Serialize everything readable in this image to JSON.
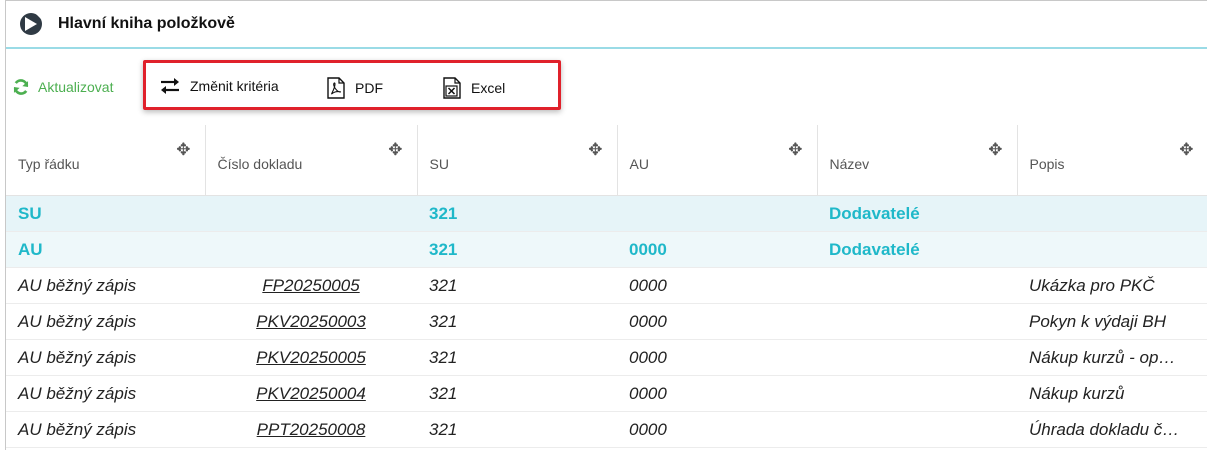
{
  "window": {
    "title": "Hlavní kniha položkově"
  },
  "toolbar": {
    "refresh_label": "Aktualizovat",
    "change_criteria_label": "Změnit kritéria",
    "pdf_label": "PDF",
    "excel_label": "Excel",
    "highlight_color": "#e0212b",
    "refresh_color": "#4caf50"
  },
  "table": {
    "headers": [
      "Typ řádku",
      "Číslo dokladu",
      "SU",
      "AU",
      "Název",
      "Popis"
    ],
    "rows": [
      {
        "type": "SU",
        "doc": "",
        "su": "321",
        "au": "",
        "name": "Dodavatelé",
        "desc": ""
      },
      {
        "type": "AU",
        "doc": "",
        "su": "321",
        "au": "0000",
        "name": "Dodavatelé",
        "desc": ""
      },
      {
        "type": "AU běžný zápis",
        "doc": "FP20250005",
        "su": "321",
        "au": "0000",
        "name": "",
        "desc": "Ukázka pro PKČ"
      },
      {
        "type": "AU běžný zápis",
        "doc": "PKV20250003",
        "su": "321",
        "au": "0000",
        "name": "",
        "desc": "Pokyn k výdaji BH"
      },
      {
        "type": "AU běžný zápis",
        "doc": "PKV20250005",
        "su": "321",
        "au": "0000",
        "name": "",
        "desc": "Nákup kurzů - op…"
      },
      {
        "type": "AU běžný zápis",
        "doc": "PKV20250004",
        "su": "321",
        "au": "0000",
        "name": "",
        "desc": "Nákup kurzů"
      },
      {
        "type": "AU běžný zápis",
        "doc": "PPT20250008",
        "su": "321",
        "au": "0000",
        "name": "",
        "desc": "Úhrada dokladu č…"
      }
    ],
    "accent_color": "#1fb8c9"
  }
}
